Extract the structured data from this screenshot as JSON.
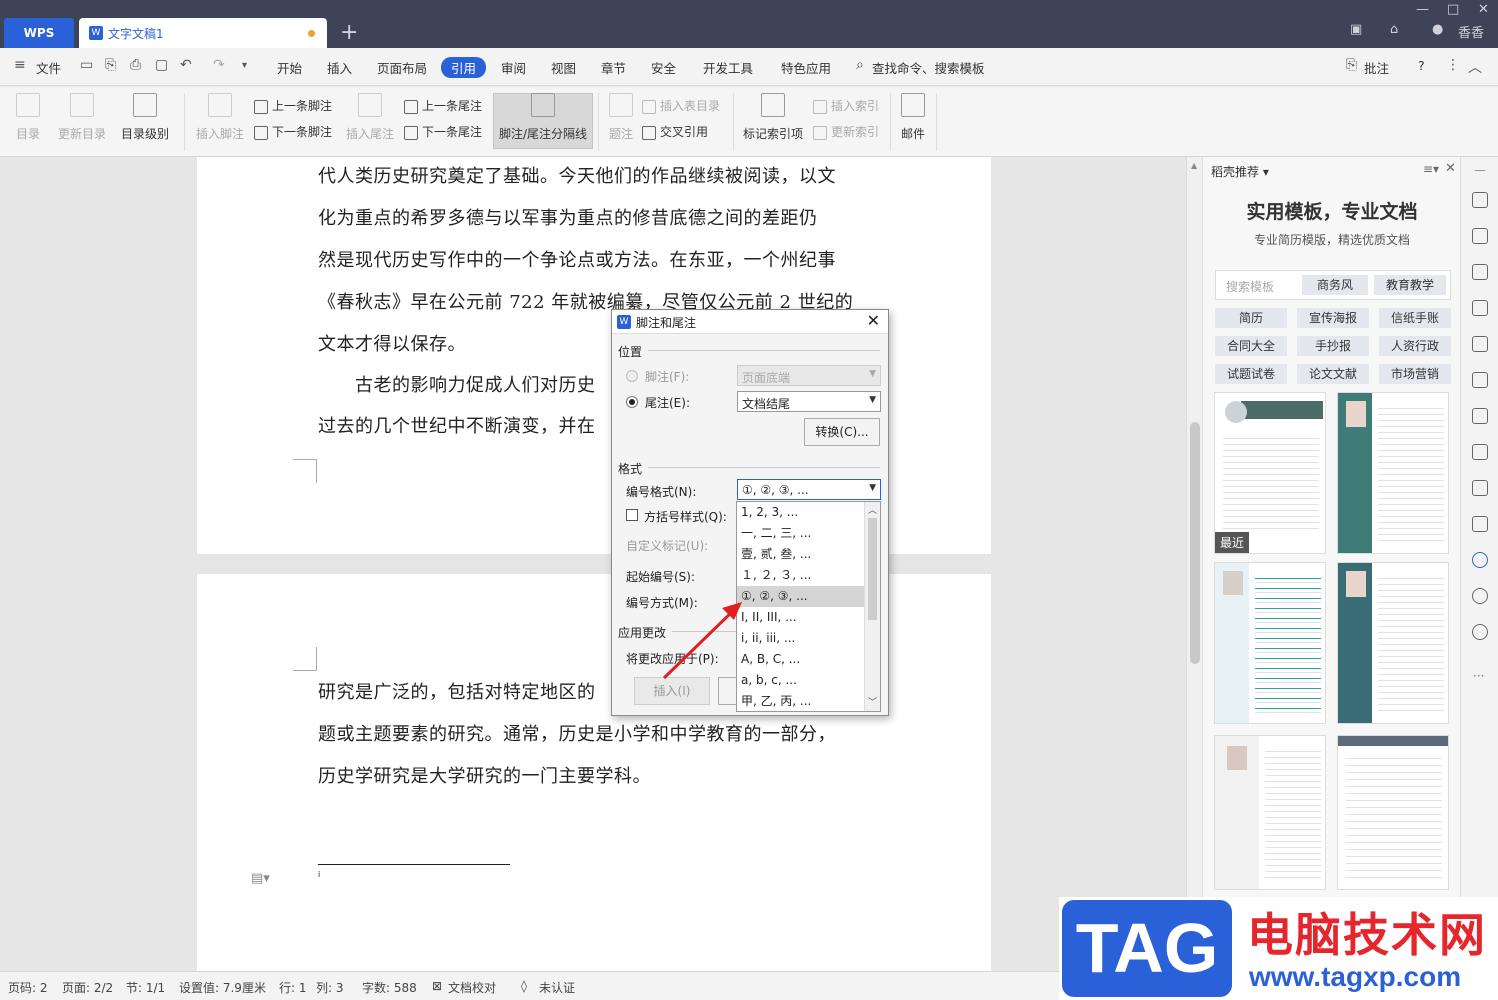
{
  "titlebar": {
    "wps_tab": "WPS",
    "doc_tab": "文字文稿1",
    "new_tab": "+",
    "user": "香香"
  },
  "menubar": {
    "file": "文件",
    "tabs": [
      "开始",
      "插入",
      "页面布局",
      "引用",
      "审阅",
      "视图",
      "章节",
      "安全",
      "开发工具",
      "特色应用"
    ],
    "active_tab": "引用",
    "search": "查找命令、搜索模板",
    "annotate": "批注",
    "help": "?"
  },
  "ribbon": {
    "toc": "目录",
    "update_toc": "更新目录",
    "toc_level": "目录级别",
    "insert_footnote": "插入脚注",
    "prev_footnote": "上一条脚注",
    "next_footnote": "下一条脚注",
    "insert_endnote": "插入尾注",
    "prev_endnote": "上一条尾注",
    "next_endnote": "下一条尾注",
    "separator": "脚注/尾注分隔线",
    "caption": "题注",
    "insert_table_toc": "插入表目录",
    "cross_ref": "交叉引用",
    "mark_index": "标记索引项",
    "insert_index": "插入索引",
    "update_index": "更新索引",
    "mail": "邮件"
  },
  "document": {
    "page1_lines": [
      "代人类历史研究奠定了基础。今天他们的作品继续被阅读，以文",
      "化为重点的希罗多德与以军事为重点的修昔底德之间的差距仍",
      "然是现代历史写作中的一个争论点或方法。在东亚，一个州纪事",
      "《春秋志》早在公元前 722 年就被编纂，尽管仅公元前 2 世纪的",
      "文本才得以保存。",
      "　　古老的影响力促成人们对历史",
      "过去的几个世纪中不断演变，并在"
    ],
    "page2_lines": [
      "研究是广泛的，包括对特定地区的",
      "题或主题要素的研究。通常，历史是小学和中学教育的一部分，",
      "历史学研究是大学研究的一门主要学科。"
    ],
    "footnote_mark": "i"
  },
  "dialog": {
    "title": "脚注和尾注",
    "position_section": "位置",
    "footnote_label": "脚注(F):",
    "footnote_value": "页面底端",
    "endnote_label": "尾注(E):",
    "endnote_value": "文档结尾",
    "convert_button": "转换(C)...",
    "format_section": "格式",
    "number_format_label": "编号格式(N):",
    "number_format_value": "①, ②, ③, ...",
    "bracket_label": "方括号样式(Q):",
    "custom_mark_label": "自定义标记(U):",
    "start_label": "起始编号(S):",
    "numbering_label": "编号方式(M):",
    "apply_section": "应用更改",
    "apply_to_label": "将更改应用于(P):",
    "insert_button": "插入(I)"
  },
  "dropdown": {
    "options": [
      "1, 2, 3, ...",
      "一, 二, 三, ...",
      "壹, 贰, 叁, ...",
      "１, ２, ３, ...",
      "①, ②, ③, ...",
      "I, II, III, ...",
      "i, ii, iii, ...",
      "A, B, C, ...",
      "a, b, c, ...",
      "甲, 乙, 丙, ..."
    ],
    "selected": "①, ②, ③, ..."
  },
  "panel": {
    "header": "稻壳推荐",
    "title": "实用模板，专业文档",
    "subtitle": "专业简历模版，精选优质文档",
    "search_placeholder": "搜索模板",
    "search_tags": [
      "商务风",
      "教育教学"
    ],
    "categories": [
      "简历",
      "宣传海报",
      "信纸手账",
      "合同大全",
      "手抄报",
      "人资行政",
      "试题试卷",
      "论文文献",
      "市场营销"
    ],
    "recent_badge": "最近"
  },
  "statusbar": {
    "page": "页码: 2",
    "pages": "页面: 2/2",
    "section": "节: 1/1",
    "setting": "设置值: 7.9厘米",
    "row": "行: 1",
    "col": "列: 3",
    "words": "字数: 588",
    "proof": "文档校对",
    "cert": "未认证"
  },
  "watermark": {
    "tag": "TAG",
    "cn": "电脑技术网",
    "url": "www.tagxp.com"
  },
  "colors": {
    "accent": "#2b61d8",
    "titlebar": "#3d4458",
    "watermark_red": "#e5262d"
  }
}
